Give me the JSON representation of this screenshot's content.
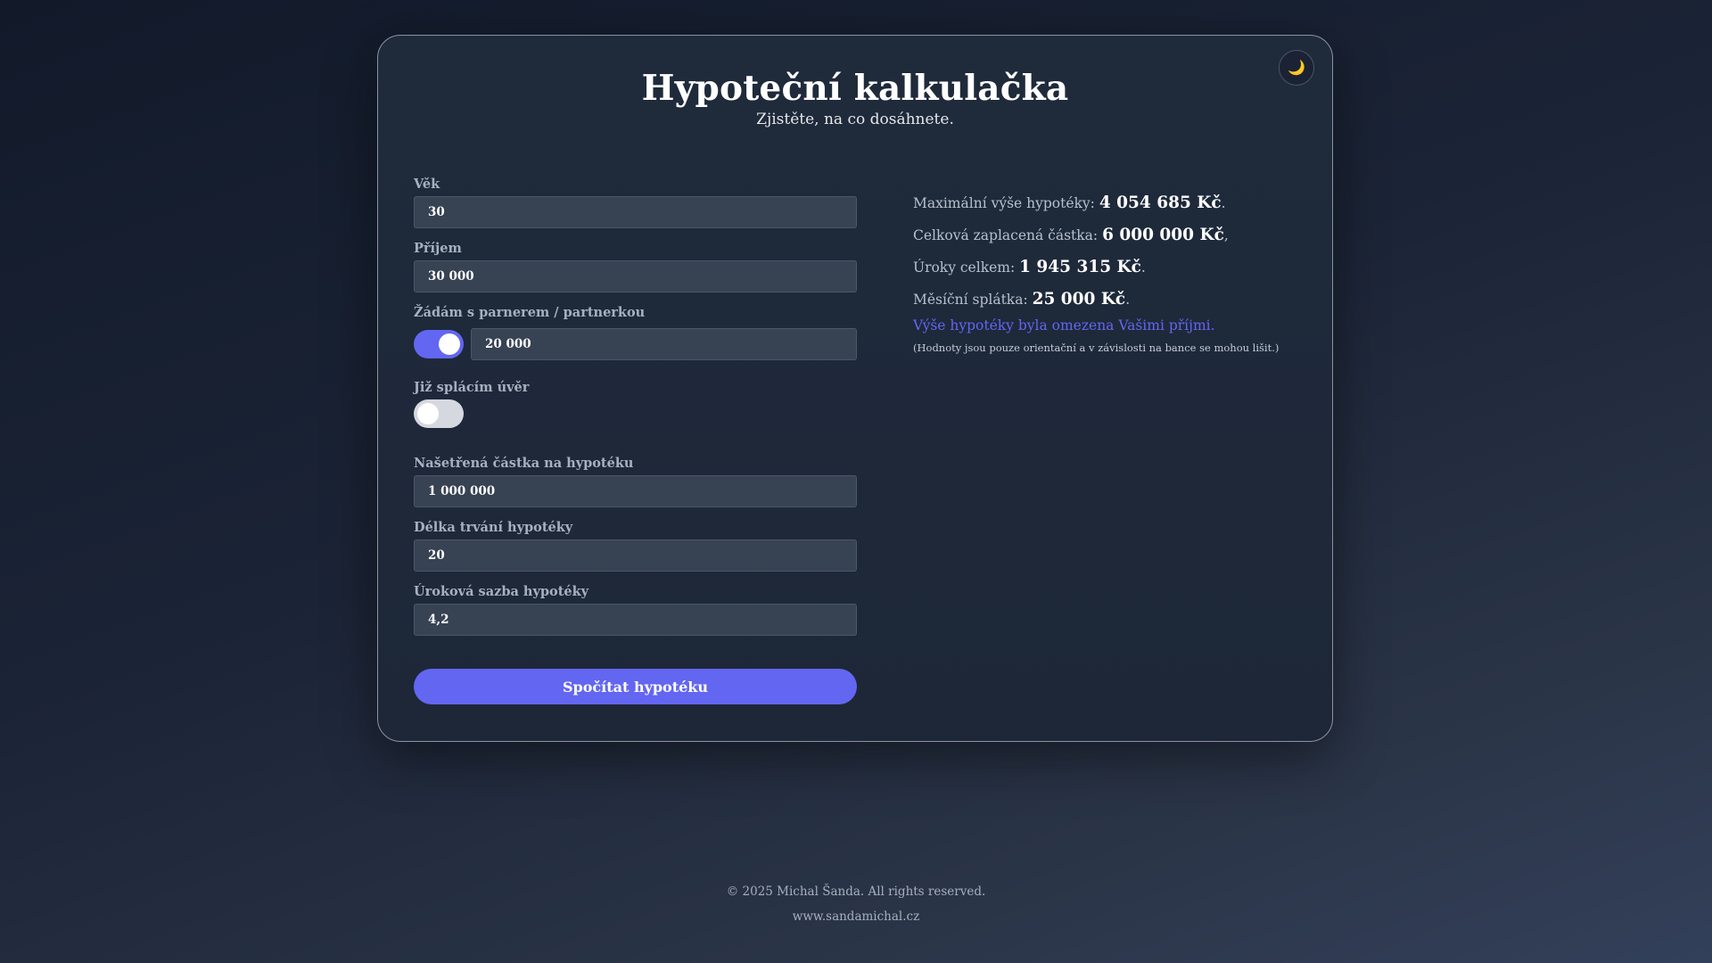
{
  "header": {
    "title": "Hypoteční kalkulačka",
    "subtitle": "Zjistěte, na co dosáhnete.",
    "theme_icon": "moon-icon",
    "theme_glyph": "🌙"
  },
  "form": {
    "age": {
      "label": "Věk",
      "value": "30"
    },
    "income": {
      "label": "Příjem",
      "value": "30 000"
    },
    "partner": {
      "label": "Žádám s parnerem / partnerkou",
      "enabled": true,
      "value": "20 000"
    },
    "existing_loan": {
      "label": "Již splácím úvěr",
      "enabled": false
    },
    "savings": {
      "label": "Našetřená částka na hypotéku",
      "value": "1 000 000"
    },
    "duration": {
      "label": "Délka trvání hypotéky",
      "value": "20"
    },
    "rate": {
      "label": "Úroková sazba hypotéky",
      "value": "4,2"
    },
    "submit_label": "Spočítat hypotéku"
  },
  "results": {
    "max_mortgage": {
      "label": "Maximální výše hypotéky: ",
      "value": "4 054 685 Kč",
      "suffix": "."
    },
    "total_paid": {
      "label": "Celková zaplacená částka: ",
      "value": "6 000 000 Kč",
      "suffix": ","
    },
    "interest_total": {
      "label": "Úroky celkem: ",
      "value": "1 945 315 Kč",
      "suffix": "."
    },
    "monthly_payment": {
      "label": "Měsíční splátka: ",
      "value": "25 000 Kč",
      "suffix": "."
    },
    "limit_note": "Výše hypotéky byla omezena Vašimi příjmi.",
    "disclaimer": "(Hodnoty jsou pouze orientační a v závislosti na bance se mohou lišit.)"
  },
  "footer": {
    "copyright": "© 2025 Michal Šanda. All rights reserved.",
    "website": "www.sandamichal.cz"
  },
  "colors": {
    "accent": "#6366f1",
    "card_border": "#8b93a3",
    "input_bg": "#374253"
  }
}
